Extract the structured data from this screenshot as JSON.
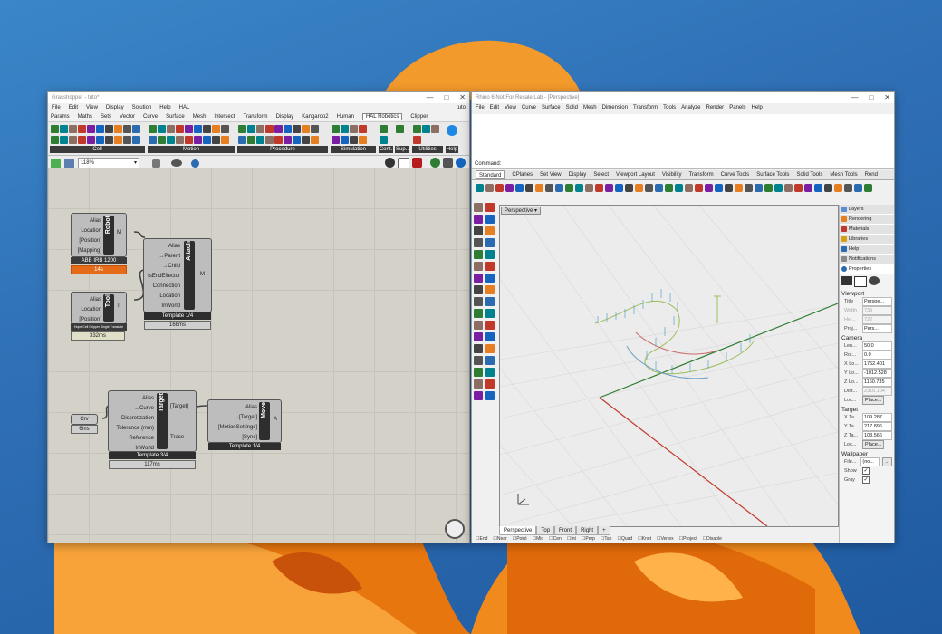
{
  "grasshopper": {
    "title": "Grasshopper - tuto*",
    "doc_name": "tuto",
    "menu": [
      "File",
      "Edit",
      "View",
      "Display",
      "Solution",
      "Help",
      "HAL"
    ],
    "tabs": [
      "Params",
      "Maths",
      "Sets",
      "Vector",
      "Curve",
      "Surface",
      "Mesh",
      "Intersect",
      "Transform",
      "Display",
      "Kangaroo2",
      "Human",
      "HAL Robotics",
      "Clipper"
    ],
    "active_tab": "HAL Robotics",
    "ribbon_groups": [
      "Cell",
      "Motion",
      "Procedure",
      "Simulation",
      "Cont.",
      "Utilities"
    ],
    "ribbon_extra": [
      "Sup..",
      "Help"
    ],
    "zoom": "118%",
    "nodes": {
      "robot": {
        "name": "Robot",
        "inputs": [
          "Alias",
          "Location",
          "[Position]",
          "[Mapping]"
        ],
        "output": "M",
        "sub": "ABB IRB 1200",
        "timing": "14s"
      },
      "tool": {
        "name": "Tool",
        "inputs": [
          "Alias",
          "Location",
          "[Position]"
        ],
        "output": "T",
        "sub": "Hope Cell Gripper Single Translate",
        "timing": "332ms"
      },
      "attach": {
        "name": "Attach",
        "inputs": [
          "Alias",
          "→Parent",
          "→Child",
          "IsEndEffector",
          "Connection",
          "Location",
          "InWorld"
        ],
        "output": "M",
        "template": "Template 1/4",
        "timing": "168ms"
      },
      "crv": {
        "name": "Crv",
        "timing": "6ms"
      },
      "target": {
        "name": "Target",
        "inputs": [
          "Alias",
          "→Curve",
          "Discretization",
          "Tolerance (mm)",
          "Reference",
          "InWorld"
        ],
        "outputs": [
          "[Target]",
          "Trace"
        ],
        "template": "Template 3/4",
        "timing": "117ms"
      },
      "move": {
        "name": "Move",
        "inputs": [
          "Alias",
          "→[Target]",
          "[MotionSettings]",
          "[Sync]"
        ],
        "output": "A",
        "template": "Template 1/4"
      }
    }
  },
  "rhino": {
    "title": "Rhino 6 Not For Resale Lab - [Perspective]",
    "menu": [
      "File",
      "Edit",
      "View",
      "Curve",
      "Surface",
      "Solid",
      "Mesh",
      "Dimension",
      "Transform",
      "Tools",
      "Analyze",
      "Render",
      "Panels",
      "Help"
    ],
    "command_label": "Command:",
    "toolbar_tabs": [
      "Standard",
      "CPlanes",
      "Set View",
      "Display",
      "Select",
      "Viewport Layout",
      "Visibility",
      "Transform",
      "Curve Tools",
      "Surface Tools",
      "Solid Tools",
      "Mesh Tools",
      "Rend"
    ],
    "viewport_label": "Perspective",
    "viewport_tabs": [
      "Perspective",
      "Top",
      "Front",
      "Right",
      "+"
    ],
    "snaps": [
      "End",
      "Near",
      "Point",
      "Mid",
      "Cen",
      "Int",
      "Perp",
      "Tan",
      "Quad",
      "Knot",
      "Vertex",
      "Project",
      "Disable"
    ],
    "panel_tabs": [
      "Layers",
      "Rendering",
      "Materials",
      "Libraries",
      "Help",
      "Notifications",
      "Properties"
    ],
    "viewport": {
      "section": "Viewport",
      "rows": [
        [
          "Title",
          "Perspe..."
        ],
        [
          "Width",
          "739"
        ],
        [
          "Hei...",
          "722"
        ],
        [
          "Proj...",
          "Pers..."
        ]
      ]
    },
    "camera": {
      "section": "Camera",
      "rows": [
        [
          "Len...",
          "50.0"
        ],
        [
          "Rot...",
          "0.0"
        ],
        [
          "X Lo...",
          "1762.401"
        ],
        [
          "Y Lo...",
          "-1012.528"
        ],
        [
          "Z Lo...",
          "1160.735"
        ],
        [
          "Dist...",
          "2316.104"
        ],
        [
          "Loc...",
          "Place..."
        ]
      ]
    },
    "target": {
      "section": "Target",
      "rows": [
        [
          "X Ta...",
          "109.287"
        ],
        [
          "Y Ta...",
          "217.896"
        ],
        [
          "Z Ta...",
          "103.566"
        ],
        [
          "Loc...",
          "Place..."
        ]
      ]
    },
    "wallpaper": {
      "section": "Wallpaper",
      "rows": [
        [
          "File...",
          "(no..."
        ],
        [
          "Show",
          "✓"
        ],
        [
          "Gray",
          "✓"
        ]
      ]
    }
  },
  "colors": {
    "desktop": "#2f6fb5",
    "bloom": "#f08a1c",
    "x_axis": "#c0392b",
    "y_axis": "#2e7d32"
  }
}
